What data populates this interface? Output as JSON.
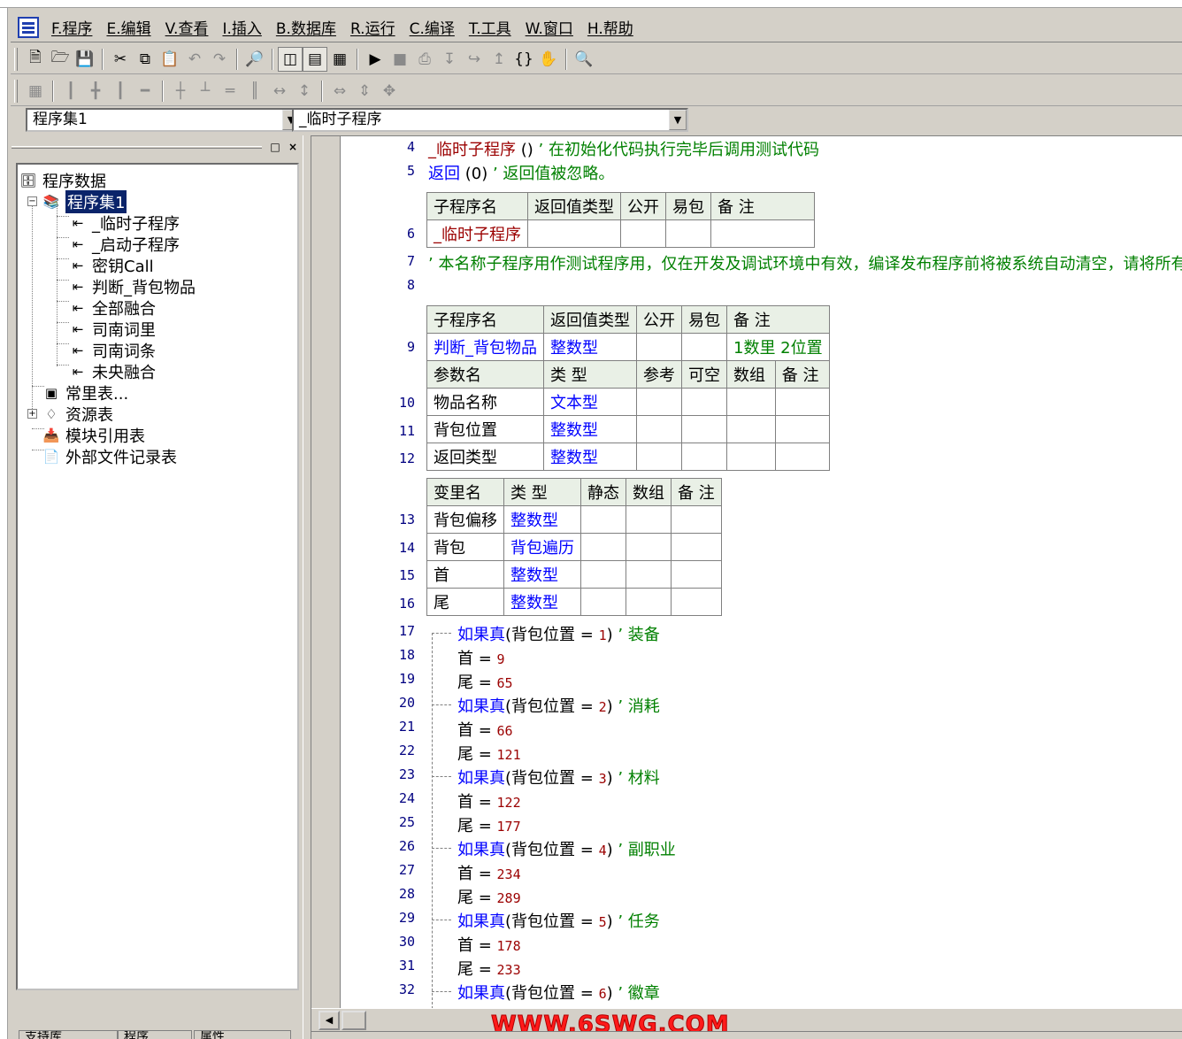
{
  "menu": [
    "F.程序",
    "E.编辑",
    "V.查看",
    "I.插入",
    "B.数据库",
    "R.运行",
    "C.编译",
    "T.工具",
    "W.窗口",
    "H.帮助"
  ],
  "toolbar1_icons": [
    "new-file",
    "open-folder",
    "save",
    "cut",
    "copy",
    "paste",
    "undo",
    "redo",
    "find",
    "layout-1",
    "layout-2",
    "layout-3",
    "run",
    "stop",
    "step-icon",
    "step-into",
    "step-over",
    "step-out",
    "braces",
    "hand",
    "search-binocular"
  ],
  "combos": {
    "assembly": "程序集1",
    "subroutine": "_临时子程序"
  },
  "tree": {
    "root": "程序数据",
    "assembly": "程序集1",
    "subs": [
      "_临时子程序",
      "_启动子程序",
      "密钥Call",
      "判断_背包物品",
      "全部融合",
      "司南词里",
      "司南词条",
      "未央融合"
    ],
    "constants": "常里表...",
    "resources": "资源表",
    "modules": "模块引用表",
    "external": "外部文件记录表"
  },
  "tabs": [
    "支持库",
    "程序",
    "属性"
  ],
  "code": {
    "line4": {
      "num": "4",
      "call": "_临时子程序",
      "parens": "()",
      "comment": "’ 在初始化代码执行完毕后调用测试代码"
    },
    "line5": {
      "num": "5",
      "kw": "返回",
      "arg": "(0)",
      "comment": "’ 返回值被忽略。"
    },
    "sub1": {
      "headers": [
        "子程序名",
        "返回值类型",
        "公开",
        "易包",
        "备 注"
      ],
      "rownum": "6",
      "name": "_临时子程序"
    },
    "line7": {
      "num": "7",
      "comment": "’ 本名称子程序用作测试程序用，仅在开发及调试环境中有效，编译发布程序前将被系统自动清空，请将所有"
    },
    "line8": {
      "num": "8"
    },
    "sub2": {
      "headers": [
        "子程序名",
        "返回值类型",
        "公开",
        "易包",
        "备 注"
      ],
      "rownum": "9",
      "name": "判断_背包物品",
      "rettype": "整数型",
      "note": "1数里 2位置",
      "param_headers": [
        "参数名",
        "类 型",
        "参考",
        "可空",
        "数组",
        "备 注"
      ],
      "params": [
        {
          "num": "10",
          "name": "物品名称",
          "type": "文本型"
        },
        {
          "num": "11",
          "name": "背包位置",
          "type": "整数型"
        },
        {
          "num": "12",
          "name": "返回类型",
          "type": "整数型"
        }
      ]
    },
    "vars": {
      "headers": [
        "变里名",
        "类 型",
        "静态",
        "数组",
        "备 注"
      ],
      "rows": [
        {
          "num": "13",
          "name": "背包偏移",
          "type": "整数型"
        },
        {
          "num": "14",
          "name": "背包",
          "type": "背包遍历"
        },
        {
          "num": "15",
          "name": "首",
          "type": "整数型"
        },
        {
          "num": "16",
          "name": "尾",
          "type": "整数型"
        }
      ]
    },
    "ifs": [
      {
        "num": "17",
        "kw": "如果真",
        "cond": "(背包位置 = ",
        "val": "1",
        "close": ")",
        "comment": "’ 装备"
      },
      {
        "num": "20",
        "kw": "如果真",
        "cond": "(背包位置 = ",
        "val": "2",
        "close": ")",
        "comment": "’ 消耗"
      },
      {
        "num": "23",
        "kw": "如果真",
        "cond": "(背包位置 = ",
        "val": "3",
        "close": ")",
        "comment": "’ 材料"
      },
      {
        "num": "26",
        "kw": "如果真",
        "cond": "(背包位置 = ",
        "val": "4",
        "close": ")",
        "comment": "’ 副职业"
      },
      {
        "num": "29",
        "kw": "如果真",
        "cond": "(背包位置 = ",
        "val": "5",
        "close": ")",
        "comment": "’ 任务"
      },
      {
        "num": "32",
        "kw": "如果真",
        "cond": "(背包位置 = ",
        "val": "6",
        "close": ")",
        "comment": "’ 徽章"
      }
    ],
    "assigns": [
      {
        "num": "18",
        "var": "首",
        "eq": " = ",
        "val": "9"
      },
      {
        "num": "19",
        "var": "尾",
        "eq": " = ",
        "val": "65"
      },
      {
        "num": "21",
        "var": "首",
        "eq": " = ",
        "val": "66"
      },
      {
        "num": "22",
        "var": "尾",
        "eq": " = ",
        "val": "121"
      },
      {
        "num": "24",
        "var": "首",
        "eq": " = ",
        "val": "122"
      },
      {
        "num": "25",
        "var": "尾",
        "eq": " = ",
        "val": "177"
      },
      {
        "num": "27",
        "var": "首",
        "eq": " = ",
        "val": "234"
      },
      {
        "num": "28",
        "var": "尾",
        "eq": " = ",
        "val": "289"
      },
      {
        "num": "30",
        "var": "首",
        "eq": " = ",
        "val": "178"
      },
      {
        "num": "31",
        "var": "尾",
        "eq": " = ",
        "val": "233"
      }
    ]
  },
  "watermark": "WWW.6SWG.COM"
}
